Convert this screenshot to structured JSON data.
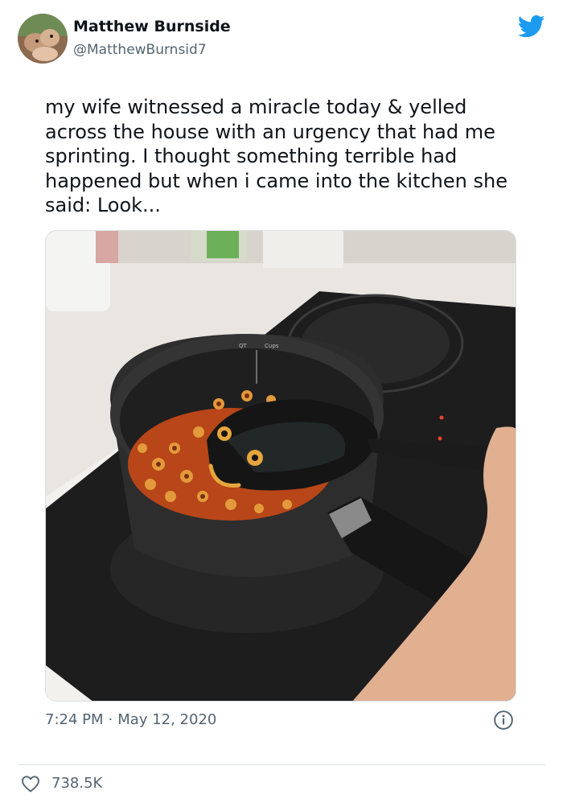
{
  "author": {
    "name": "Matthew Burnside",
    "handle": "@MatthewBurnsid7"
  },
  "tweet": {
    "text": "my wife witnessed a miracle today & yelled across the house with an urgency that had me sprinting. I thought something terrible had happened but when i came into the kitchen she said: Look..."
  },
  "meta": {
    "time": "7:24 PM",
    "separator": "·",
    "date": "May 12, 2020"
  },
  "engagement": {
    "likes": "738.5K"
  },
  "icons": {
    "brand": "twitter-bird-icon",
    "info": "info-icon",
    "like": "heart-icon"
  },
  "colors": {
    "twitter_blue": "#1d9bf0",
    "secondary_text": "#536471",
    "primary_text": "#0f1419"
  }
}
